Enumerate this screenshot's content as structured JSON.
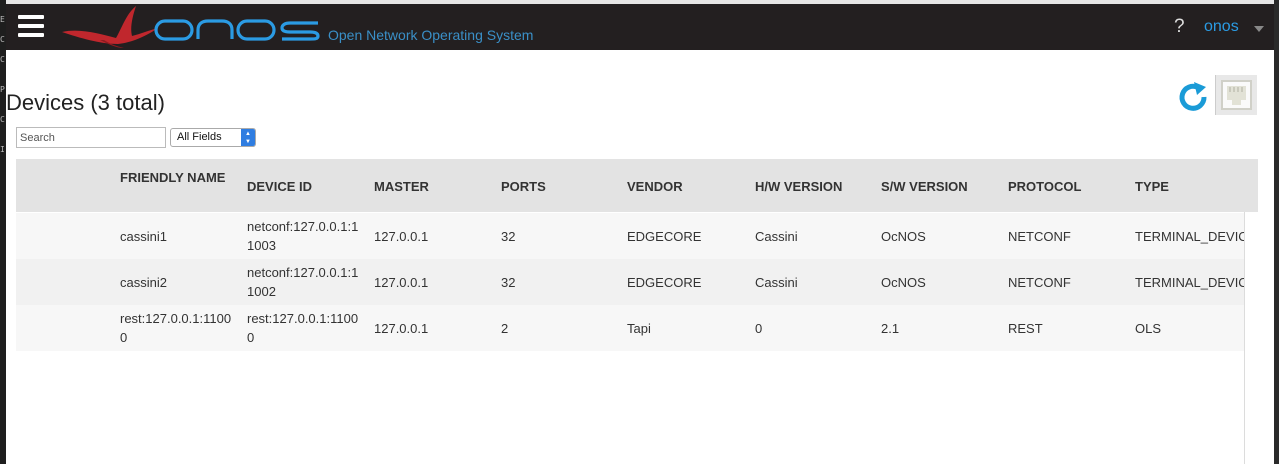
{
  "sidebar_glyphs": [
    "E",
    "C",
    "C",
    "P",
    "C",
    "I"
  ],
  "header": {
    "logo_text": "onos",
    "tagline": "Open Network Operating System",
    "help_label": "?",
    "user_name": "onos"
  },
  "page": {
    "title": "Devices (3 total)"
  },
  "search": {
    "placeholder": "Search",
    "field_selected": "All Fields"
  },
  "table": {
    "columns": [
      "FRIENDLY NAME",
      "DEVICE ID",
      "MASTER",
      "PORTS",
      "VENDOR",
      "H/W VERSION",
      "S/W VERSION",
      "PROTOCOL",
      "TYPE"
    ],
    "rows": [
      {
        "friendly_name": [
          "cassini1",
          ""
        ],
        "device_id": [
          "netconf:127.0.0.1:1",
          "1003"
        ],
        "master": "127.0.0.1",
        "ports": "32",
        "vendor": "EDGECORE",
        "hw_version": "Cassini",
        "sw_version": "OcNOS",
        "protocol": "NETCONF",
        "type": "TERMINAL_DEVICE"
      },
      {
        "friendly_name": [
          "cassini2",
          ""
        ],
        "device_id": [
          "netconf:127.0.0.1:1",
          "1002"
        ],
        "master": "127.0.0.1",
        "ports": "32",
        "vendor": "EDGECORE",
        "hw_version": "Cassini",
        "sw_version": "OcNOS",
        "protocol": "NETCONF",
        "type": "TERMINAL_DEVICE"
      },
      {
        "friendly_name": [
          "rest:127.0.0.1:1100",
          "0"
        ],
        "device_id": [
          "rest:127.0.0.1:1100",
          "0"
        ],
        "master": "127.0.0.1",
        "ports": "2",
        "vendor": "Tapi",
        "hw_version": "0",
        "sw_version": "2.1",
        "protocol": "REST",
        "type": "OLS"
      }
    ]
  },
  "colors": {
    "masthead": "#231f20",
    "brand_blue": "#2b9be3",
    "logo_red": "#c0272d",
    "header_bg": "#e3e3e3"
  },
  "icons": [
    "menu-icon",
    "onos-bird-icon",
    "refresh-icon",
    "port-icon",
    "caret-down-icon"
  ]
}
